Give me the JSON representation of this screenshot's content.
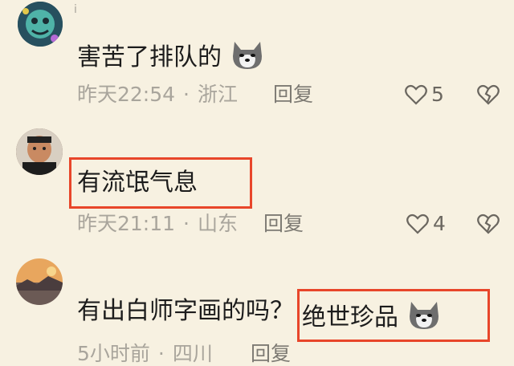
{
  "comments": [
    {
      "text": "害苦了排队的",
      "time": "昨天22:54",
      "location": "浙江",
      "reply_label": "回复",
      "likes": "5",
      "badge": "ⅰ"
    },
    {
      "text": "有流氓气息",
      "time": "昨天21:11",
      "location": "山东",
      "reply_label": "回复",
      "likes": "4"
    },
    {
      "text": "有出白师字画的吗？",
      "highlight": "绝世珍品",
      "time": "5小时前",
      "location": "四川",
      "reply_label": "回复"
    }
  ],
  "separator": "·",
  "colors": {
    "background": "#f7f1e1",
    "highlight_box": "#e8462a",
    "meta_text": "#a9a59c"
  }
}
